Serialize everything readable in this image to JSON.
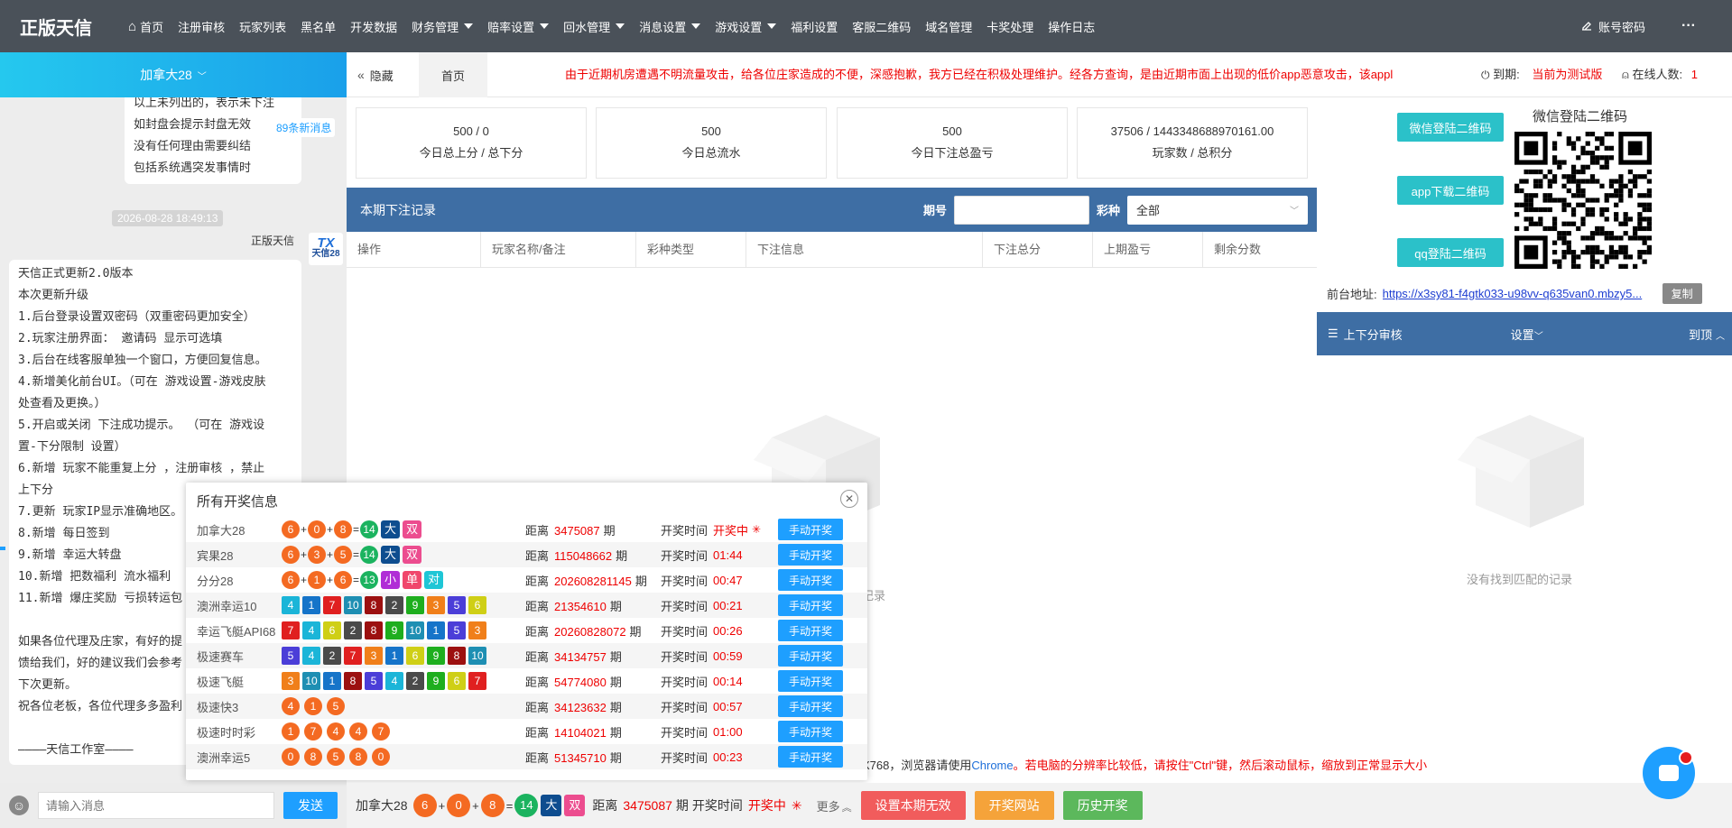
{
  "app": {
    "logo": "正版天信"
  },
  "nav": {
    "items": [
      {
        "label": "首页",
        "icon": "home-icon",
        "caret": false
      },
      {
        "label": "注册审核",
        "caret": false
      },
      {
        "label": "玩家列表",
        "caret": false
      },
      {
        "label": "黑名单",
        "caret": false
      },
      {
        "label": "开发数据",
        "caret": false
      },
      {
        "label": "财务管理",
        "caret": true
      },
      {
        "label": "赔率设置",
        "caret": true
      },
      {
        "label": "回水管理",
        "caret": true
      },
      {
        "label": "消息设置",
        "caret": true
      },
      {
        "label": "游戏设置",
        "caret": true
      },
      {
        "label": "福利设置",
        "caret": false
      },
      {
        "label": "客服二维码",
        "caret": false
      },
      {
        "label": "域名管理",
        "caret": false
      },
      {
        "label": "卡奖处理",
        "caret": false
      },
      {
        "label": "操作日志",
        "caret": false
      }
    ],
    "account_label": "账号密码",
    "more_label": "···"
  },
  "subbar": {
    "user": "加拿大28",
    "hide_label": "隐藏",
    "home_tab": "首页",
    "marquee": "由于近期机房遭遇不明流量攻击，给各位庄家造成的不便，深感抱歉，我方已经在积极处理维护。经各方查询，是由近期市面上出现的低价app恶意攻击，该appl",
    "expire_label": "到期:",
    "expire_value": "当前为测试版",
    "online_label": "在线人数:",
    "online_value": "1"
  },
  "chat": {
    "top_bubble": [
      "以上未列出的，表示未下注",
      "如封盘会提示封盘无效",
      "没有任何理由需要纠结",
      "包括系统遇突发事情时"
    ],
    "new_messages": "89条新消息",
    "timestamp": "2026-08-28 18:49:13",
    "sender": "正版天信",
    "avatar_top": "TX",
    "avatar_bottom": "天信28",
    "main_bubble": [
      "天信正式更新2.0版本",
      "本次更新升级",
      "1.后台登录设置双密码（双重密码更加安全）",
      "2.玩家注册界面： 邀请码 显示可选填",
      "3.后台在线客服单独一个窗口，方便回复信息。",
      "4.新增美化前台UI。（可在 游戏设置-游戏皮肤",
      "处查看及更换。）",
      "5.开启或关闭 下注成功提示。 （可在 游戏设",
      "置-下分限制 设置）",
      "6.新增 玩家不能重复上分 ，注册审核 ，禁止",
      "上下分",
      "7.更新 玩家IP显示准确地区。",
      "8.新增 每日签到",
      "9.新增 幸运大转盘",
      "10.新增 把数福利 流水福利",
      "11.新增 爆庄奖励 亏损转运包",
      "",
      "如果各位代理及庄家，有好的提",
      "馈给我们，好的建议我们会参考",
      "下次更新。",
      "祝各位老板，各位代理多多盈利",
      "",
      "————天信工作室————"
    ],
    "input_placeholder": "请输入消息",
    "send_label": "发送"
  },
  "stats": [
    {
      "value": "500 / 0",
      "label": "今日总上分 / 总下分"
    },
    {
      "value": "500",
      "label": "今日总流水"
    },
    {
      "value": "500",
      "label": "今日下注总盈亏"
    },
    {
      "value": "37506 / 1443348688970161.00",
      "label": "玩家数 / 总积分"
    }
  ],
  "records": {
    "title": "本期下注记录",
    "period_label": "期号",
    "period_value": "",
    "lottery_label": "彩种",
    "lottery_value": "全部",
    "columns": [
      "操作",
      "玩家名称/备注",
      "彩种类型",
      "下注信息",
      "下注总分",
      "上期盈亏",
      "剩余分数"
    ],
    "empty_text": "没有找到匹配的记录"
  },
  "right": {
    "buttons": [
      "微信登陆二维码",
      "app下载二维码",
      "qq登陆二维码"
    ],
    "qr_title": "微信登陆二维码",
    "frontend_label": "前台地址:",
    "frontend_url": "https://x3sy81-f4gtk033-u98vv-q635van0.mbzy5...",
    "copy_label": "复制",
    "audit_title": "上下分审核",
    "settings_label": "设置",
    "top_label": "到顶",
    "empty_text": "没有找到匹配的记录"
  },
  "notice": {
    "res_text": "X768，浏览器请使用",
    "chrome": "Chrome",
    "tip": "。若电脑的分辨率比较低，请按住\"Ctrl\"键，然后滚动鼠标，缩放到正常显示大小"
  },
  "popup": {
    "title": "所有开奖信息",
    "dist_label": "距离",
    "period_unit": "期",
    "time_label": "开奖时间",
    "button_label": "手动开奖",
    "rows": [
      {
        "name": "加拿大28",
        "kind": "sum",
        "balls": [
          "6",
          "0",
          "8"
        ],
        "sum": "14",
        "tags": [
          {
            "t": "大",
            "c": "#0e4d8f"
          },
          {
            "t": "双",
            "c": "#ec4d8f"
          }
        ],
        "period": "3475087",
        "time": "开奖中",
        "spinner": true
      },
      {
        "name": "宾果28",
        "kind": "sum",
        "balls": [
          "6",
          "3",
          "5"
        ],
        "sum": "14",
        "tags": [
          {
            "t": "大",
            "c": "#0e4d8f"
          },
          {
            "t": "双",
            "c": "#ec4d8f"
          }
        ],
        "period": "115048662",
        "time": "01:44",
        "spinner": false
      },
      {
        "name": "分分28",
        "kind": "sum",
        "balls": [
          "6",
          "1",
          "6"
        ],
        "sum": "13",
        "tags": [
          {
            "t": "小",
            "c": "#b02ed6"
          },
          {
            "t": "单",
            "c": "#f0476c"
          },
          {
            "t": "对",
            "c": "#1ec6d6"
          }
        ],
        "period": "202608281145",
        "time": "00:47",
        "spinner": false
      },
      {
        "name": "澳洲幸运10",
        "kind": "square",
        "balls": [
          "4",
          "1",
          "7",
          "10",
          "8",
          "2",
          "9",
          "3",
          "5",
          "6"
        ],
        "period": "21354610",
        "time": "00:21",
        "spinner": false
      },
      {
        "name": "幸运飞艇API68",
        "kind": "square",
        "balls": [
          "7",
          "4",
          "6",
          "2",
          "8",
          "9",
          "10",
          "1",
          "5",
          "3"
        ],
        "period": "20260828072",
        "time": "00:26",
        "spinner": false
      },
      {
        "name": "极速赛车",
        "kind": "square",
        "balls": [
          "5",
          "4",
          "2",
          "7",
          "3",
          "1",
          "6",
          "9",
          "8",
          "10"
        ],
        "period": "34134757",
        "time": "00:59",
        "spinner": false
      },
      {
        "name": "极速飞艇",
        "kind": "square",
        "balls": [
          "3",
          "10",
          "1",
          "8",
          "5",
          "4",
          "2",
          "9",
          "6",
          "7"
        ],
        "period": "54774080",
        "time": "00:14",
        "spinner": false
      },
      {
        "name": "极速快3",
        "kind": "ball",
        "balls": [
          "4",
          "1",
          "5"
        ],
        "period": "34123632",
        "time": "00:57",
        "spinner": false
      },
      {
        "name": "极速时时彩",
        "kind": "ball",
        "balls": [
          "1",
          "7",
          "4",
          "4",
          "7"
        ],
        "period": "14104021",
        "time": "01:00",
        "spinner": false
      },
      {
        "name": "澳洲幸运5",
        "kind": "ball",
        "balls": [
          "0",
          "8",
          "5",
          "8",
          "0"
        ],
        "period": "51345710",
        "time": "00:23",
        "spinner": false
      }
    ]
  },
  "bottom": {
    "game": "加拿大28",
    "balls": [
      "6",
      "0",
      "8"
    ],
    "sum": "14",
    "tags": [
      {
        "t": "大",
        "c": "#0e4d8f"
      },
      {
        "t": "双",
        "c": "#ec4d8f"
      }
    ],
    "dist_label": "距离",
    "period": "3475087",
    "period_unit": "期",
    "time_label": "开奖时间",
    "status": "开奖中",
    "more_label": "更多",
    "btn_invalid": "设置本期无效",
    "btn_site": "开奖网站",
    "btn_history": "历史开奖"
  },
  "colors": {
    "nav_bg": "#4a5159",
    "accent_blue": "#3e6ea4",
    "cyan": "#2bc1c9",
    "orange_ball": "#f46a22",
    "green_sum": "#1bb35f",
    "square_colors": {
      "1": "#1674c9",
      "2": "#4a4a4a",
      "3": "#f07f1a",
      "4": "#1bb5d8",
      "5": "#4b3ed8",
      "6": "#cfcf16",
      "7": "#e02020",
      "8": "#9c1010",
      "9": "#1eae1e",
      "10": "#1e8fb3"
    }
  }
}
